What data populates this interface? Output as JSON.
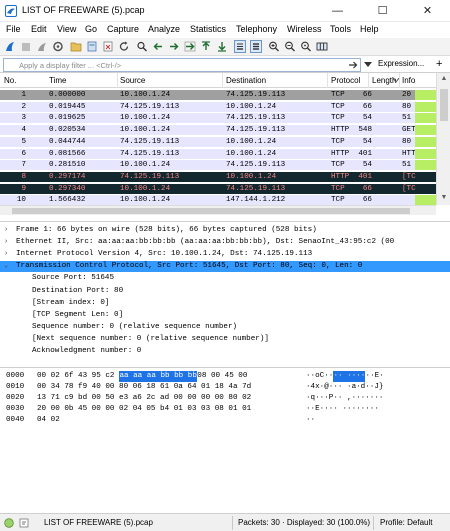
{
  "window": {
    "title": "LIST OF FREEWARE (5).pcap",
    "controls": {
      "minimize": "—",
      "maximize": "☐",
      "close": "✕"
    }
  },
  "menu": [
    "File",
    "Edit",
    "View",
    "Go",
    "Capture",
    "Analyze",
    "Statistics",
    "Telephony",
    "Wireless",
    "Tools",
    "Help"
  ],
  "toolbar": {
    "icons": [
      "shark-fin-start-icon",
      "stop-icon",
      "restart-icon",
      "options-gear-icon",
      "open-folder-icon",
      "save-file-icon",
      "close-file-icon",
      "reload-icon",
      "find-icon",
      "go-back-icon",
      "go-forward-icon",
      "go-to-packet-icon",
      "go-first-icon",
      "go-last-icon",
      "autoscroll-icon",
      "colorize-icon",
      "zoom-in-icon",
      "zoom-out-icon",
      "zoom-normal-icon",
      "resize-columns-icon"
    ]
  },
  "filter": {
    "placeholder": "Apply a display filter ... <Ctrl-/>",
    "expression_label": "Expression...",
    "add_label": "+"
  },
  "packet_list": {
    "columns": [
      "No.",
      "Time",
      "Source",
      "Destination",
      "Protocol",
      "Length",
      "Info"
    ],
    "rows": [
      {
        "no": "1",
        "time": "0.000000",
        "src": "10.100.1.24",
        "dst": "74.125.19.113",
        "proto": "TCP",
        "len": "66",
        "info": "20",
        "style": "syn"
      },
      {
        "no": "2",
        "time": "0.019445",
        "src": "74.125.19.113",
        "dst": "10.100.1.24",
        "proto": "TCP",
        "len": "66",
        "info": "80",
        "style": "tcp"
      },
      {
        "no": "3",
        "time": "0.019625",
        "src": "10.100.1.24",
        "dst": "74.125.19.113",
        "proto": "TCP",
        "len": "54",
        "info": "51",
        "style": "tcp"
      },
      {
        "no": "4",
        "time": "0.020534",
        "src": "10.100.1.24",
        "dst": "74.125.19.113",
        "proto": "HTTP",
        "len": "548",
        "info": "GET",
        "style": "tcp"
      },
      {
        "no": "5",
        "time": "0.044744",
        "src": "74.125.19.113",
        "dst": "10.100.1.24",
        "proto": "TCP",
        "len": "54",
        "info": "80",
        "style": "tcp"
      },
      {
        "no": "6",
        "time": "0.081566",
        "src": "74.125.19.113",
        "dst": "10.100.1.24",
        "proto": "HTTP",
        "len": "401",
        "info": "HTT",
        "style": "tcp"
      },
      {
        "no": "7",
        "time": "0.281510",
        "src": "10.100.1.24",
        "dst": "74.125.19.113",
        "proto": "TCP",
        "len": "54",
        "info": "51",
        "style": "tcp"
      },
      {
        "no": "8",
        "time": "0.297174",
        "src": "74.125.19.113",
        "dst": "10.100.1.24",
        "proto": "HTTP",
        "len": "401",
        "info": "[TC",
        "style": "bad"
      },
      {
        "no": "9",
        "time": "0.297340",
        "src": "10.100.1.24",
        "dst": "74.125.19.113",
        "proto": "TCP",
        "len": "66",
        "info": "[TC",
        "style": "bad"
      },
      {
        "no": "10",
        "time": "1.566432",
        "src": "10.100.1.24",
        "dst": "147.144.1.212",
        "proto": "TCP",
        "len": "66",
        "info": "",
        "style": "tcp"
      }
    ]
  },
  "details": [
    {
      "expander": "›",
      "text": "Frame 1: 66 bytes on wire (528 bits), 66 bytes captured (528 bits)",
      "indent": 0,
      "selected": false
    },
    {
      "expander": "›",
      "text": "Ethernet II, Src: aa:aa:aa:bb:bb:bb (aa:aa:aa:bb:bb:bb), Dst: SenaoInt_43:95:c2 (00",
      "indent": 0,
      "selected": false
    },
    {
      "expander": "›",
      "text": "Internet Protocol Version 4, Src: 10.100.1.24, Dst: 74.125.19.113",
      "indent": 0,
      "selected": false
    },
    {
      "expander": "⌄",
      "text": "Transmission Control Protocol, Src Port: 51645, Dst Port: 80, Seq: 0, Len: 0",
      "indent": 0,
      "selected": true
    },
    {
      "expander": "",
      "text": "Source Port: 51645",
      "indent": 1,
      "selected": false
    },
    {
      "expander": "",
      "text": "Destination Port: 80",
      "indent": 1,
      "selected": false
    },
    {
      "expander": "",
      "text": "[Stream index: 0]",
      "indent": 1,
      "selected": false
    },
    {
      "expander": "",
      "text": "[TCP Segment Len: 0]",
      "indent": 1,
      "selected": false
    },
    {
      "expander": "",
      "text": "Sequence number: 0    (relative sequence number)",
      "indent": 1,
      "selected": false
    },
    {
      "expander": "",
      "text": "[Next sequence number: 0    (relative sequence number)]",
      "indent": 1,
      "selected": false
    },
    {
      "expander": "",
      "text": "Acknowledgment number: 0",
      "indent": 1,
      "selected": false
    }
  ],
  "bytes": [
    {
      "offset": "0000",
      "hex_pre": "00 02 6f 43 95 c2 ",
      "hex_hl": "aa aa aa bb bb bb",
      "hex_post": " 08 00 45 00",
      "ascii_pre": "··oC··",
      "ascii_hl": "·· ····",
      "ascii_post": "··E·"
    },
    {
      "offset": "0010",
      "hex_pre": "00 34 78 f9 40 00 80 06  18 61 0a 64 01 18 4a 7d",
      "hex_hl": "",
      "hex_post": "",
      "ascii_pre": "·4x·@··· ·a·d··J}",
      "ascii_hl": "",
      "ascii_post": ""
    },
    {
      "offset": "0020",
      "hex_pre": "13 71 c9 bd 00 50 e3 a6  2c ad 00 00 00 00 80 02",
      "hex_hl": "",
      "hex_post": "",
      "ascii_pre": "·q···P·· ,·······",
      "ascii_hl": "",
      "ascii_post": ""
    },
    {
      "offset": "0030",
      "hex_pre": "20 00 0b 45 00 00 02 04  05 b4 01 03 03 08 01 01",
      "hex_hl": "",
      "hex_post": "",
      "ascii_pre": " ··E···· ········",
      "ascii_hl": "",
      "ascii_post": ""
    },
    {
      "offset": "0040",
      "hex_pre": "04 02",
      "hex_hl": "",
      "hex_post": "",
      "ascii_pre": "··",
      "ascii_hl": "",
      "ascii_post": ""
    }
  ],
  "status": {
    "file": "LIST OF FREEWARE (5).pcap",
    "packets": "Packets: 30 · Displayed: 30 (100.0%)",
    "profile": "Profile: Default"
  },
  "colors": {
    "tcp_row": "#e7e6ff",
    "syn_row": "#a0a0a0",
    "bad_row_bg": "#12272e",
    "bad_row_fg": "#f78787",
    "selection": "#3399ff",
    "byte_highlight": "#1e73e6",
    "info_marker": "#b7ee64"
  }
}
